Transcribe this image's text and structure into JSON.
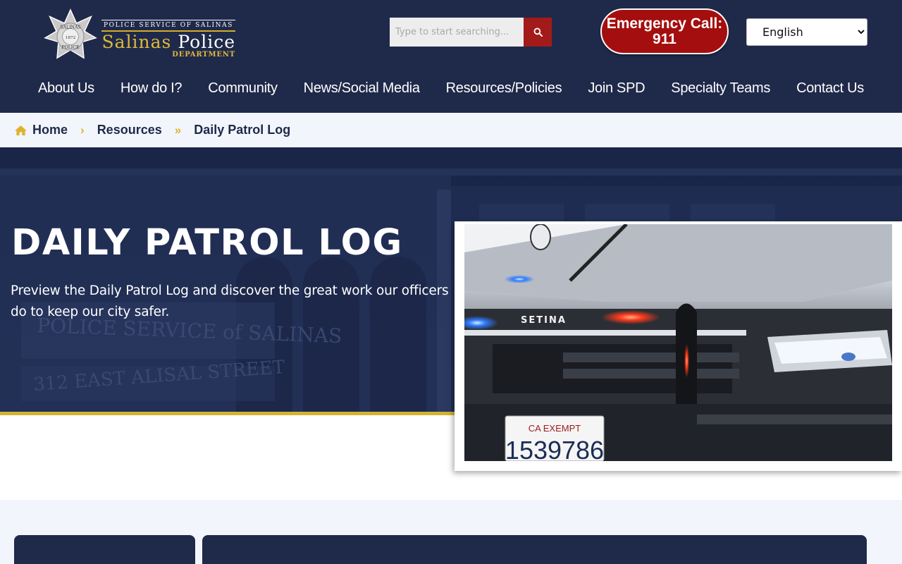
{
  "header": {
    "logo": {
      "badge_text_top": "SALINAS",
      "badge_year": "1872",
      "badge_text_bottom": "POLICE",
      "tagline": "POLICE SERVICE OF SALINAS",
      "name_part1": "Salinas",
      "name_part2": "Police",
      "department": "DEPARTMENT"
    },
    "search": {
      "placeholder": "Type to start searching..."
    },
    "emergency": {
      "line1": "Emergency Call:",
      "line2": "911"
    },
    "language": {
      "selected": "English"
    },
    "nav": [
      "About Us",
      "How do I?",
      "Community",
      "News/Social Media",
      "Resources/Policies",
      "Join SPD",
      "Specialty Teams",
      "Contact Us"
    ]
  },
  "breadcrumb": {
    "home": "Home",
    "resources": "Resources",
    "current": "Daily Patrol Log"
  },
  "hero": {
    "title": "DAILY PATROL LOG",
    "subtitle": "Preview the Daily Patrol Log and discover the great work our officers do to keep our city safer.",
    "background_sign_line1": "POLICE SERVICE of SALINAS",
    "background_sign_line2": "312 EAST ALISAL STREET",
    "photo": {
      "grille_text": "SETINA",
      "plate_top": "CA EXEMPT",
      "plate_number": "1539786"
    }
  },
  "colors": {
    "navy": "#1f2a4a",
    "gold": "#d3b333",
    "emergency_red": "#a40e0e"
  }
}
